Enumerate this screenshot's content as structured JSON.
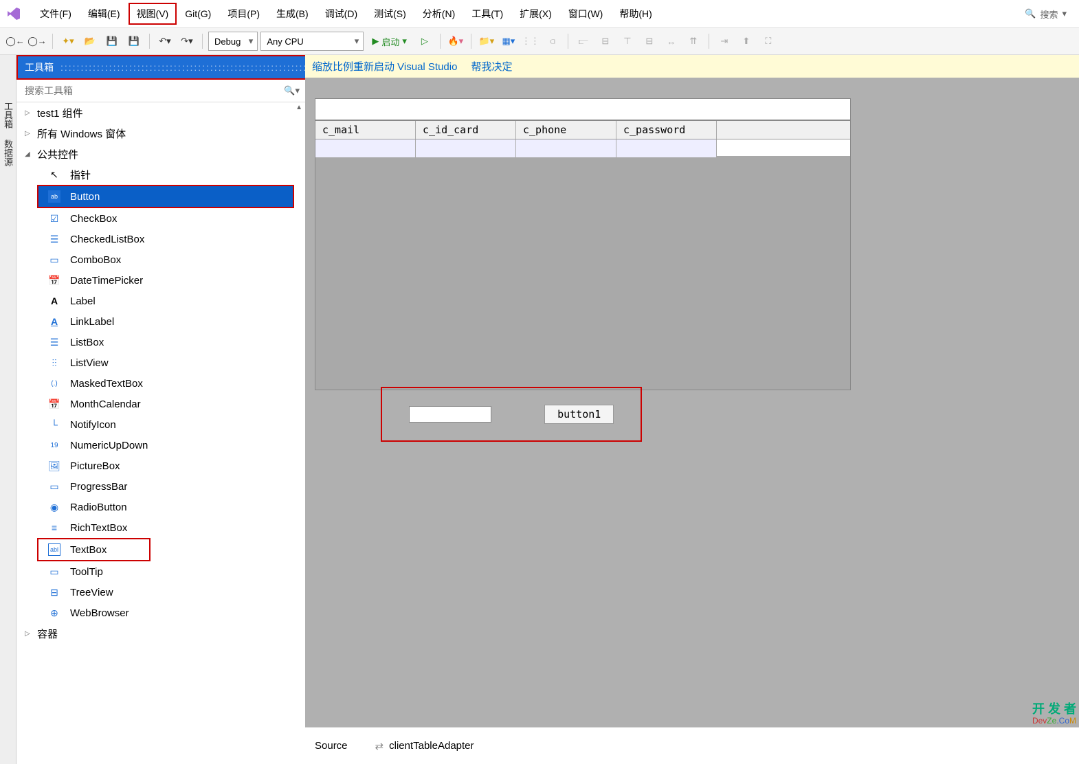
{
  "menu": {
    "file": "文件(F)",
    "edit": "编辑(E)",
    "view": "视图(V)",
    "git": "Git(G)",
    "project": "项目(P)",
    "build": "生成(B)",
    "debug": "调试(D)",
    "test": "测试(S)",
    "analyze": "分析(N)",
    "tools": "工具(T)",
    "extensions": "扩展(X)",
    "window": "窗口(W)",
    "help": "帮助(H)",
    "search": "搜索"
  },
  "toolbar": {
    "config": "Debug",
    "platform": "Any CPU",
    "start": "启动"
  },
  "vert_tabs": {
    "toolbox": "工具箱",
    "datasource": "数据源"
  },
  "toolbox": {
    "title": "工具箱",
    "title_btns": [
      "▾",
      "⊓",
      "✕"
    ],
    "search_placeholder": "搜索工具箱",
    "categories": [
      {
        "label": "test1 组件",
        "expanded": false
      },
      {
        "label": "所有 Windows 窗体",
        "expanded": false
      },
      {
        "label": "公共控件",
        "expanded": true
      }
    ],
    "controls": [
      {
        "icon": "↖",
        "label": "指针"
      },
      {
        "icon": "ab",
        "label": "Button",
        "selected": true
      },
      {
        "icon": "☑",
        "label": "CheckBox"
      },
      {
        "icon": "☰",
        "label": "CheckedListBox"
      },
      {
        "icon": "▭",
        "label": "ComboBox"
      },
      {
        "icon": "📅",
        "label": "DateTimePicker"
      },
      {
        "icon": "A",
        "label": "Label"
      },
      {
        "icon": "A",
        "label": "LinkLabel"
      },
      {
        "icon": "☰",
        "label": "ListBox"
      },
      {
        "icon": "⫶⫶",
        "label": "ListView"
      },
      {
        "icon": "(.)",
        "label": "MaskedTextBox"
      },
      {
        "icon": "📅",
        "label": "MonthCalendar"
      },
      {
        "icon": "└",
        "label": "NotifyIcon"
      },
      {
        "icon": "19",
        "label": "NumericUpDown"
      },
      {
        "icon": "🖼",
        "label": "PictureBox"
      },
      {
        "icon": "▭",
        "label": "ProgressBar"
      },
      {
        "icon": "◉",
        "label": "RadioButton"
      },
      {
        "icon": "≡",
        "label": "RichTextBox"
      },
      {
        "icon": "abl",
        "label": "TextBox"
      },
      {
        "icon": "▭",
        "label": "ToolTip"
      },
      {
        "icon": "⊟",
        "label": "TreeView"
      },
      {
        "icon": "⊕",
        "label": "WebBrowser"
      }
    ],
    "collapsed_cat": "容器"
  },
  "infobar": {
    "restart": "缩放比例重新启动 Visual Studio",
    "help": "帮我决定"
  },
  "grid": {
    "cols": [
      "c_mail",
      "c_id_card",
      "c_phone",
      "c_password"
    ]
  },
  "form": {
    "button_label": "button1"
  },
  "tray": {
    "source": "Source",
    "adapter": "clientTableAdapter"
  },
  "watermark": {
    "line1": "开 发 者",
    "line2": [
      "Dev",
      "Ze",
      ".Co",
      "M"
    ]
  }
}
